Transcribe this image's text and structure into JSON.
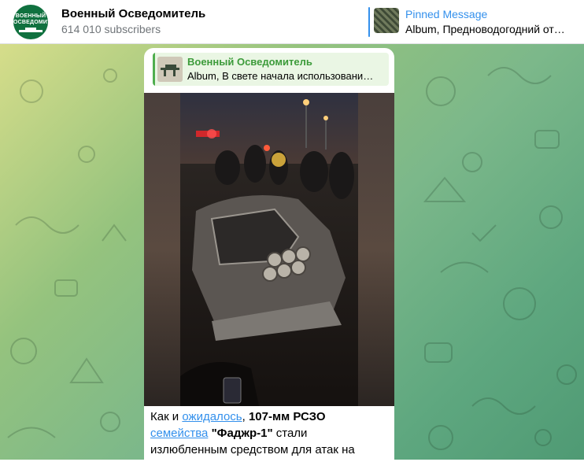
{
  "channel": {
    "name": "Военный Осведомитель",
    "subscribers": "614 010 subscribers",
    "avatar_text": "ВОЕННЫЙ ОСВЕДОМИТЕЛЬ"
  },
  "pinned": {
    "title": "Pinned Message",
    "text": "Album, Предноводогодний отче…"
  },
  "reply": {
    "author": "Военный Осведомитель",
    "text": "Album, В свете начала использовани…"
  },
  "message": {
    "t1": "Как и ",
    "link1": "ожидалось",
    "t2": ", ",
    "bold1": "107-мм РСЗО",
    "t3": " ",
    "link2": "семейства",
    "t4": " ",
    "bold2": "\"Фаджр-1\"",
    "t5": " стали излюбленным средством для атак на"
  },
  "colors": {
    "accent": "#3390ec",
    "reply_accent": "#4fae4e",
    "avatar_bg": "#10713f"
  }
}
